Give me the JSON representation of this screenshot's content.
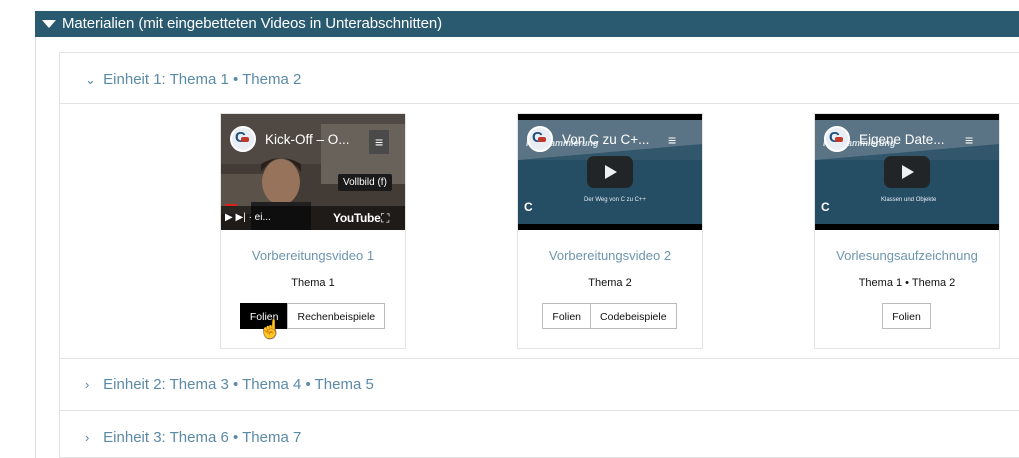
{
  "section": {
    "title": "Materialien (mit eingebetteten Videos in Unterabschnitten)"
  },
  "units": [
    {
      "label": "Einheit 1: Thema 1 • Thema 2",
      "expanded": true
    },
    {
      "label": "Einheit 2: Thema 3 • Thema 4 • Thema 5",
      "expanded": false
    },
    {
      "label": "Einheit 3: Thema 6 • Thema 7",
      "expanded": false
    }
  ],
  "videos": [
    {
      "video_title": "Kick-Off – O...",
      "fullscreen_tooltip": "Vollbild (f)",
      "youtube_label": "YouTube",
      "controls_text": "· ei...",
      "link_title": "Vorbereitungsvideo 1",
      "topic": "Thema 1",
      "buttons": [
        "Folien",
        "Rechenbeispiele"
      ]
    },
    {
      "video_title": "Von C zu C+...",
      "slide_caption": "Programmierung",
      "slide_line1": "Der Weg von C zu C++",
      "link_title": "Vorbereitungsvideo 2",
      "topic": "Thema 2",
      "buttons": [
        "Folien",
        "Codebeispiele"
      ]
    },
    {
      "video_title": "Eigene Date...",
      "slide_caption": "Programmierung",
      "slide_line1": "Klassen und Objekte",
      "link_title": "Vorlesungsaufzeichnung",
      "topic": "Thema 1 • Thema 2",
      "buttons": [
        "Folien"
      ]
    }
  ],
  "colors": {
    "header_bg": "#2a5a70",
    "link": "#5b8aa6",
    "active_button": "#000000"
  }
}
